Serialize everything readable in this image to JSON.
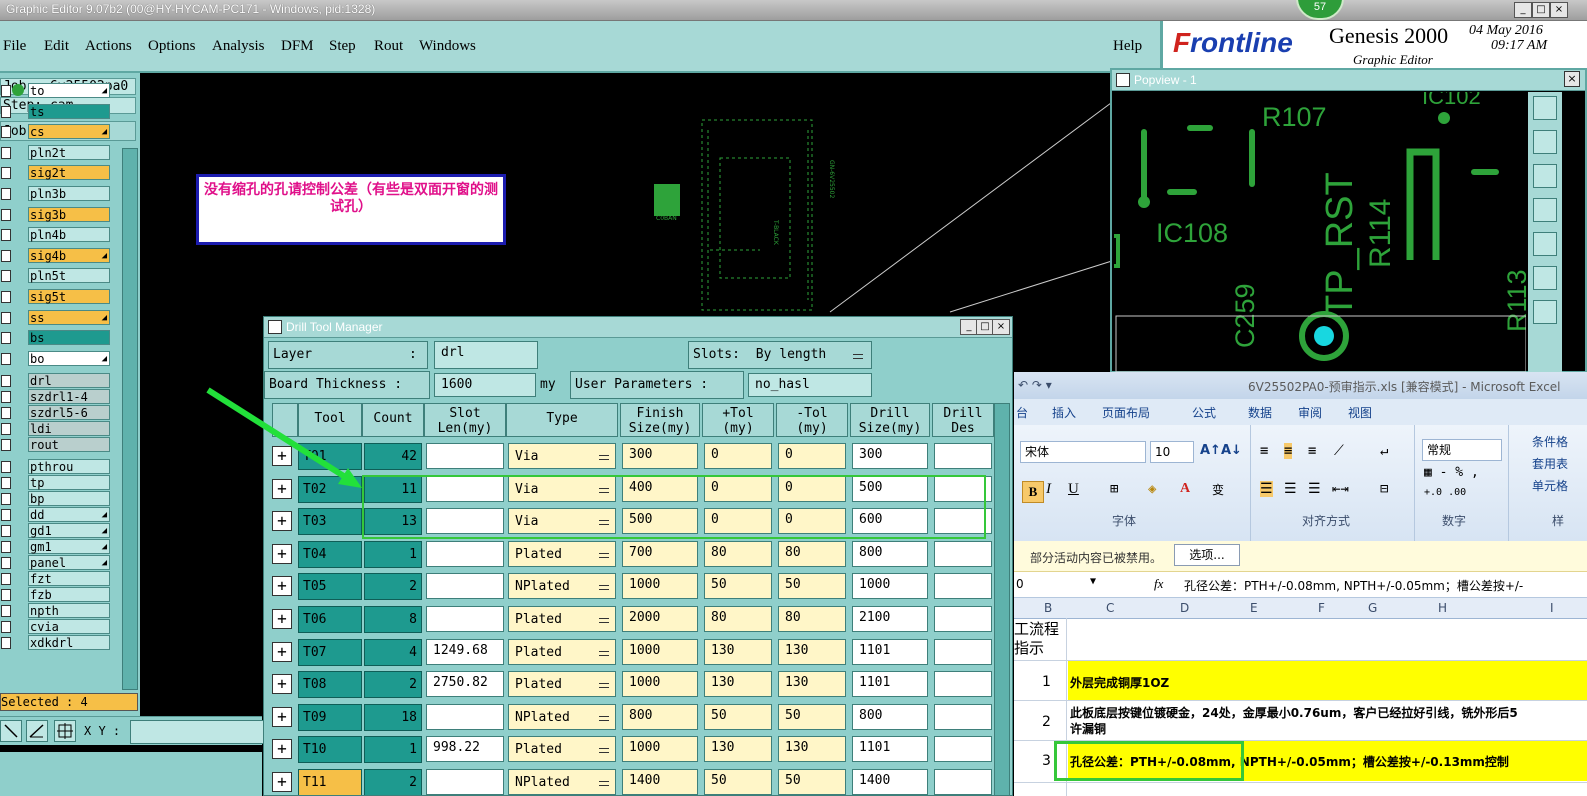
{
  "titlebar": {
    "title": "Graphic Editor 9.07b2 (00@HY-HYCAM-PC171 - Windows, pid:1328)",
    "badge": "57",
    "min": "_",
    "max": "□",
    "close": "×"
  },
  "menu": {
    "items": [
      "File",
      "Edit",
      "Actions",
      "Options",
      "Analysis",
      "DFM",
      "Step",
      "Rout",
      "Windows"
    ],
    "help": "Help"
  },
  "brand": {
    "logo_f": "F",
    "logo_rest": "rontline",
    "product": "Genesis 2000",
    "subtitle": "Graphic Editor",
    "date": "04 May 2016",
    "time": "09:17 AM"
  },
  "job": {
    "job_line": "Job : 6v25502pa0",
    "step_line": "Step: cam",
    "matrix_label": "Job Matrix ..."
  },
  "layers": [
    {
      "name": "to",
      "style": "white",
      "ptr": true,
      "dot": true
    },
    {
      "name": "ts",
      "style": "teal",
      "ptr": false
    },
    {
      "name": "cs",
      "style": "orange",
      "ptr": true
    },
    {
      "name": "pln2t",
      "style": "plain",
      "ptr": false
    },
    {
      "name": "sig2t",
      "style": "orange",
      "ptr": false
    },
    {
      "name": "pln3b",
      "style": "plain",
      "ptr": false
    },
    {
      "name": "sig3b",
      "style": "orange",
      "ptr": false
    },
    {
      "name": "pln4b",
      "style": "plain",
      "ptr": false
    },
    {
      "name": "sig4b",
      "style": "orange",
      "ptr": true
    },
    {
      "name": "pln5t",
      "style": "plain",
      "ptr": false
    },
    {
      "name": "sig5t",
      "style": "orange",
      "ptr": false
    },
    {
      "name": "ss",
      "style": "orange",
      "ptr": true
    },
    {
      "name": "bs",
      "style": "teal",
      "ptr": false
    },
    {
      "name": "bo",
      "style": "white",
      "ptr": true
    },
    {
      "name": "drl",
      "style": "gray",
      "ptr": false
    },
    {
      "name": "szdrl1-4",
      "style": "gray",
      "ptr": false
    },
    {
      "name": "szdrl5-6",
      "style": "gray",
      "ptr": false
    },
    {
      "name": "ldi",
      "style": "gray",
      "ptr": false
    },
    {
      "name": "rout",
      "style": "gray",
      "ptr": false
    },
    {
      "name": "pthrou",
      "style": "plain",
      "ptr": false
    },
    {
      "name": "tp",
      "style": "plain",
      "ptr": false
    },
    {
      "name": "bp",
      "style": "plain",
      "ptr": false
    },
    {
      "name": "dd",
      "style": "plain",
      "ptr": true
    },
    {
      "name": "gd1",
      "style": "plain",
      "ptr": true
    },
    {
      "name": "gm1",
      "style": "plain",
      "ptr": true
    },
    {
      "name": "panel",
      "style": "plain",
      "ptr": true
    },
    {
      "name": "fzt",
      "style": "plain",
      "ptr": false
    },
    {
      "name": "fzb",
      "style": "plain",
      "ptr": false
    },
    {
      "name": "npth",
      "style": "plain",
      "ptr": false
    },
    {
      "name": "cvia",
      "style": "plain",
      "ptr": false
    },
    {
      "name": "xdkdrl",
      "style": "plain",
      "ptr": false
    }
  ],
  "selected": "Selected : 4",
  "xy_label": "X Y :",
  "note": "没有缩孔的孔请控制公差（有些是双面开窗的测试孔）",
  "board_labels": [
    "C0BAN",
    "GN-6V25502",
    "T-BLACK"
  ],
  "popview": {
    "title": "Popview - 1",
    "close": "×",
    "labels": {
      "r107": "R107",
      "ic102": "IC102",
      "tprst": "TP_RST",
      "r114": "R114",
      "ic108": "IC108",
      "c259": "C259",
      "r113": "R113"
    }
  },
  "drill": {
    "title": "Drill Tool Manager",
    "layer_label": "Layer",
    "layer_colon": ":",
    "layer_value": "drl",
    "slots_label": "Slots:",
    "slots_value": "By length",
    "board_thickness_label": "Board Thickness :",
    "board_thickness_value": "1600",
    "unit": "my",
    "user_params_label": "User Parameters :",
    "user_params_value": "no_hasl",
    "headers": [
      "Tool",
      "Count",
      "Slot Len(my)",
      "Type",
      "Finish Size(my)",
      "+Tol (my)",
      "-Tol (my)",
      "Drill Size(my)",
      "Drill Des"
    ],
    "rows": [
      {
        "tool": "T01",
        "count": "42",
        "slot": "",
        "type": "Via",
        "finish": "300",
        "ptol": "0",
        "ntol": "0",
        "drill": "300"
      },
      {
        "tool": "T02",
        "count": "11",
        "slot": "",
        "type": "Via",
        "finish": "400",
        "ptol": "0",
        "ntol": "0",
        "drill": "500"
      },
      {
        "tool": "T03",
        "count": "13",
        "slot": "",
        "type": "Via",
        "finish": "500",
        "ptol": "0",
        "ntol": "0",
        "drill": "600"
      },
      {
        "tool": "T04",
        "count": "1",
        "slot": "",
        "type": "Plated",
        "finish": "700",
        "ptol": "80",
        "ntol": "80",
        "drill": "800"
      },
      {
        "tool": "T05",
        "count": "2",
        "slot": "",
        "type": "NPlated",
        "finish": "1000",
        "ptol": "50",
        "ntol": "50",
        "drill": "1000"
      },
      {
        "tool": "T06",
        "count": "8",
        "slot": "",
        "type": "Plated",
        "finish": "2000",
        "ptol": "80",
        "ntol": "80",
        "drill": "2100"
      },
      {
        "tool": "T07",
        "count": "4",
        "slot": "1249.68",
        "type": "Plated",
        "finish": "1000",
        "ptol": "130",
        "ntol": "130",
        "drill": "1101"
      },
      {
        "tool": "T08",
        "count": "2",
        "slot": "2750.82",
        "type": "Plated",
        "finish": "1000",
        "ptol": "130",
        "ntol": "130",
        "drill": "1101"
      },
      {
        "tool": "T09",
        "count": "18",
        "slot": "",
        "type": "NPlated",
        "finish": "800",
        "ptol": "50",
        "ntol": "50",
        "drill": "800"
      },
      {
        "tool": "T10",
        "count": "1",
        "slot": "998.22",
        "type": "Plated",
        "finish": "1000",
        "ptol": "130",
        "ntol": "130",
        "drill": "1101"
      },
      {
        "tool": "T11",
        "count": "2",
        "slot": "",
        "type": "NPlated",
        "finish": "1400",
        "ptol": "50",
        "ntol": "50",
        "drill": "1400"
      }
    ]
  },
  "excel": {
    "title": "6V25502PA0-预审指示.xls [兼容模式] - Microsoft Excel",
    "tabs": [
      "台",
      "插入",
      "页面布局",
      "公式",
      "数据",
      "审阅",
      "视图"
    ],
    "font_name": "宋体",
    "font_size": "10",
    "number_format": "常规",
    "groups": [
      "字体",
      "对齐方式",
      "数字",
      "样"
    ],
    "right_items": [
      "条件格",
      "套用表",
      "单元格"
    ],
    "security_msg": "部分活动内容已被禁用。",
    "options_btn": "选项...",
    "name_box": "0",
    "fx": "fx",
    "formula": "孔径公差：PTH+/-0.08mm, NPTH+/-0.05mm；槽公差按+/-",
    "cols": [
      "B",
      "C",
      "D",
      "E",
      "F",
      "G",
      "H",
      "I"
    ],
    "header_cell": "工流程\n指示",
    "rows": [
      {
        "num": "1",
        "text": "外层完成铜厚1OZ",
        "highlight": true
      },
      {
        "num": "2",
        "text": "此板底层按键位镀硬金，24处，金厚最小0.76um，客户已经拉好引线，铣外形后5\n许漏铜",
        "highlight": false
      },
      {
        "num": "3",
        "text": "孔径公差：PTH+/-0.08mm, NPTH+/-0.05mm；槽公差按+/-0.13mm控制",
        "highlight": true
      }
    ]
  }
}
